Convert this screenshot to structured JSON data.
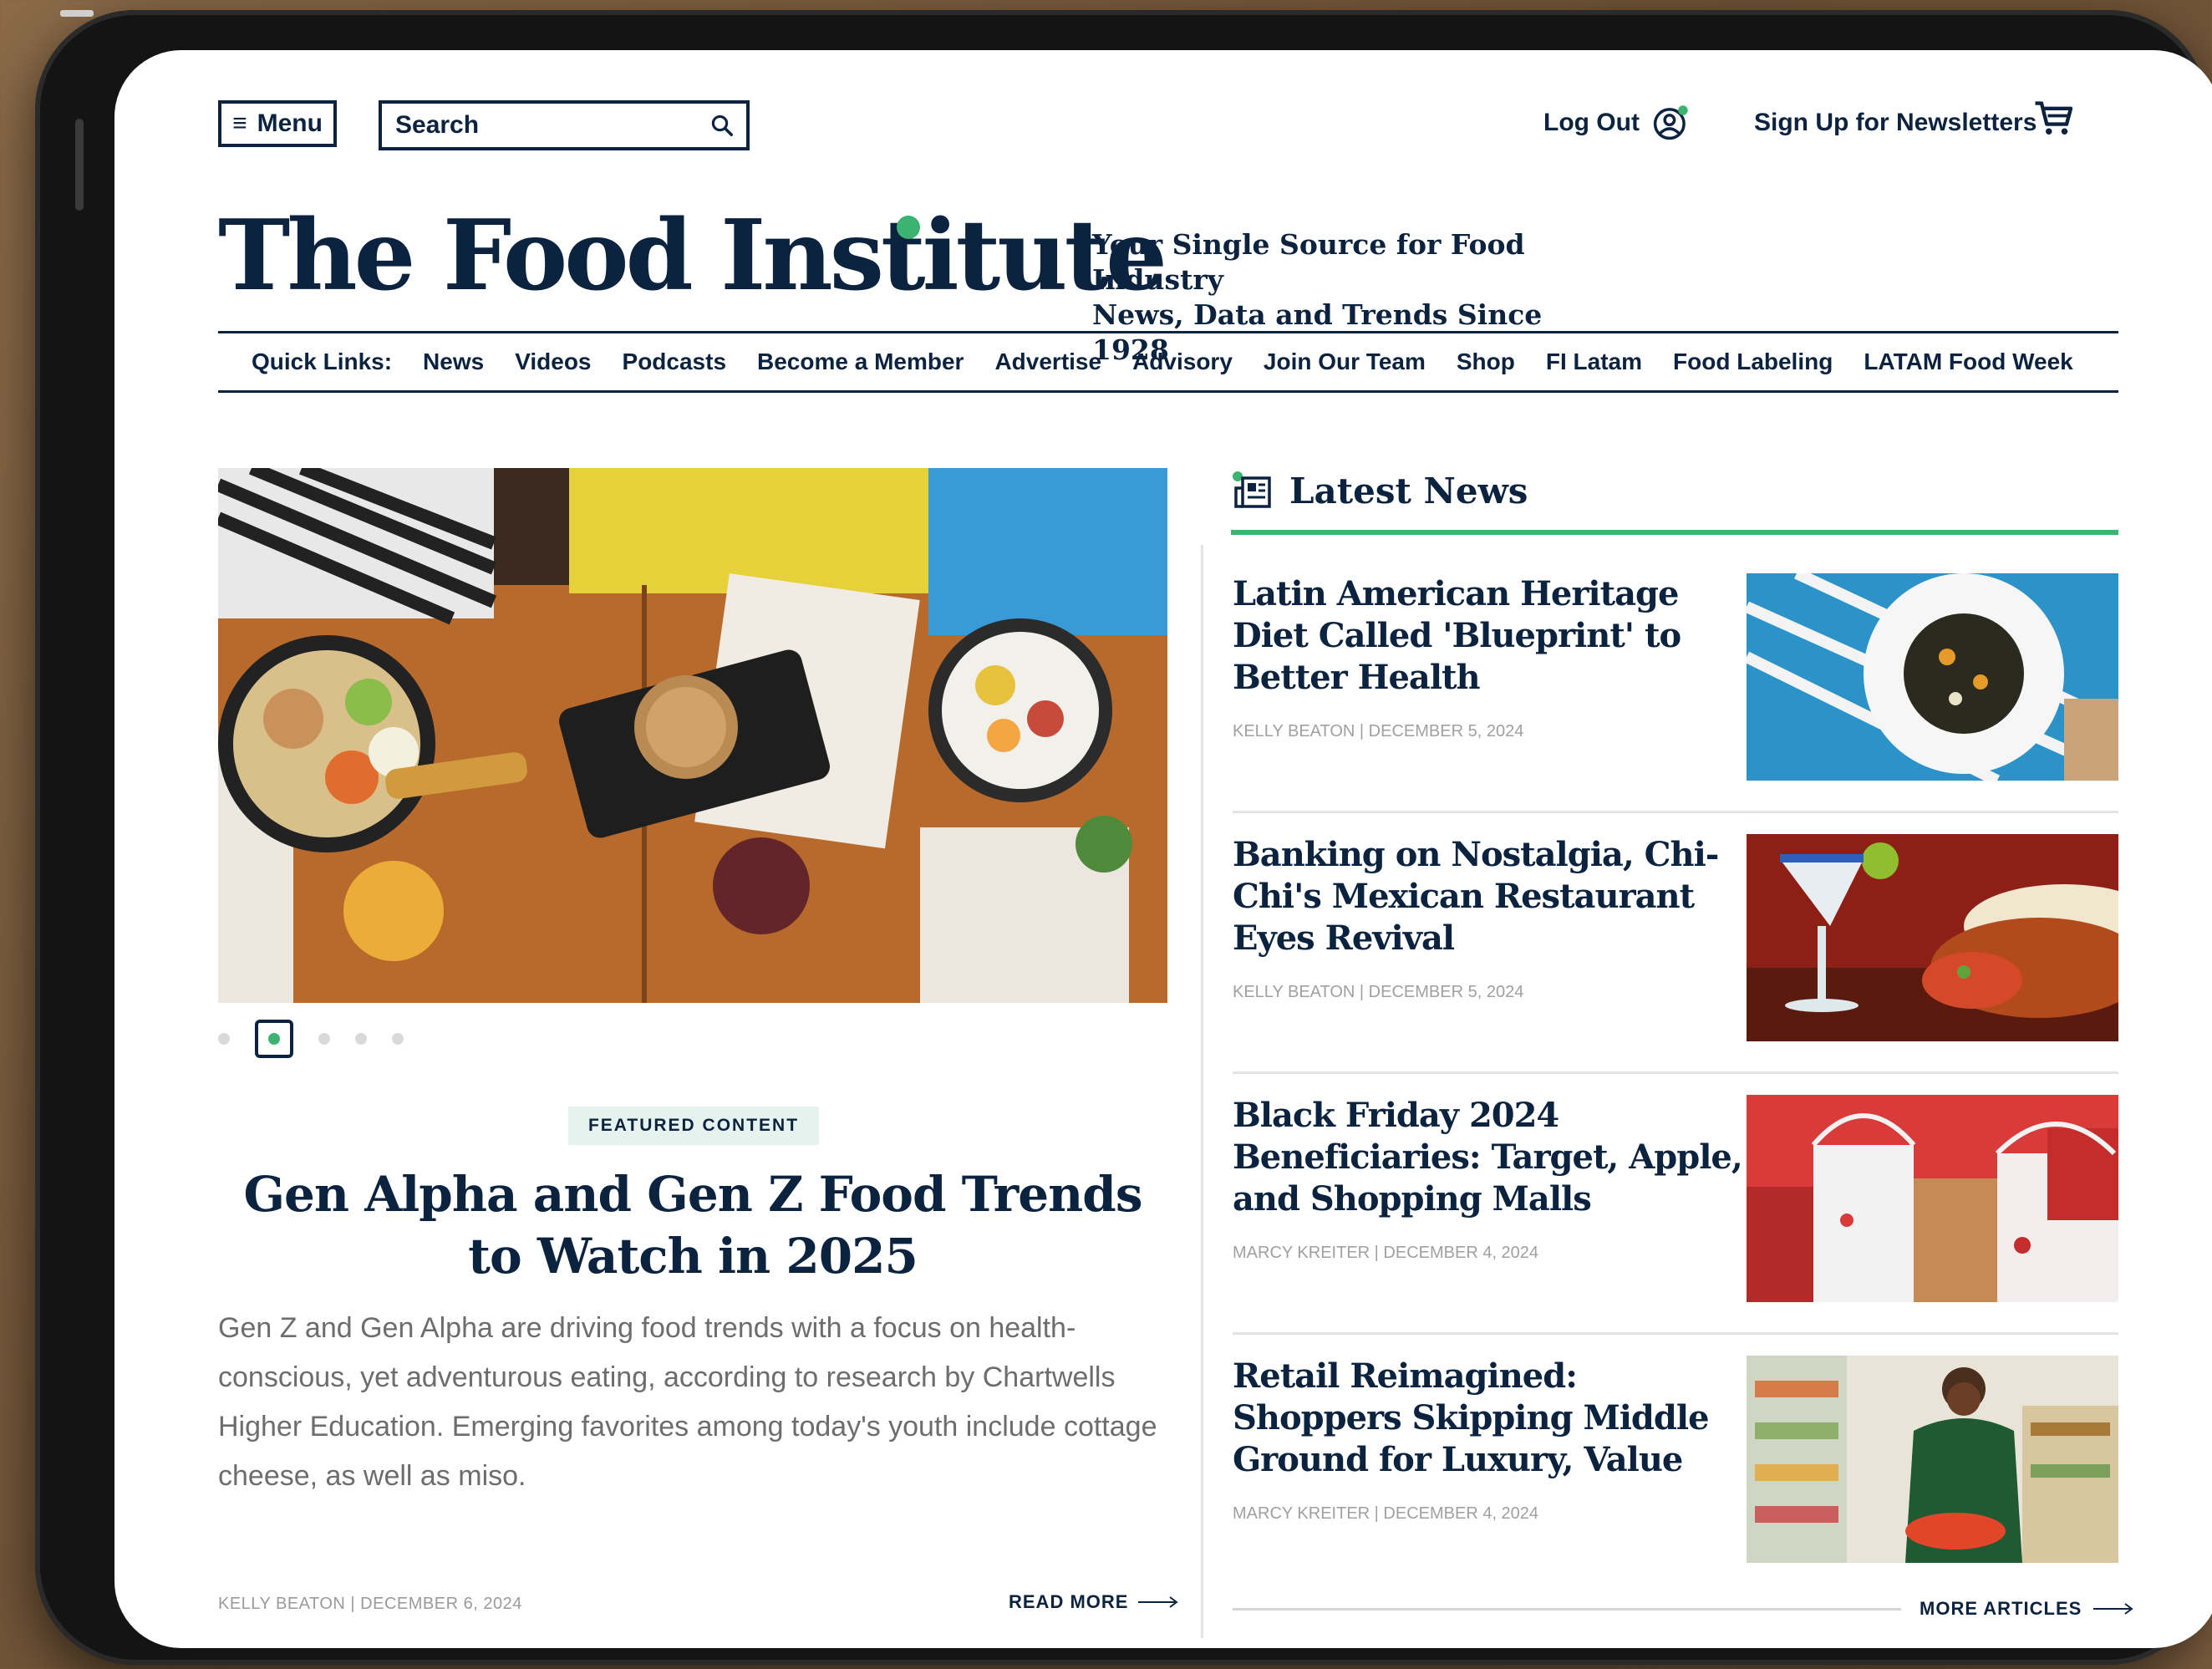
{
  "header": {
    "menu_label": "Menu",
    "search_placeholder": "Search",
    "logout_label": "Log Out",
    "newsletter_label": "Sign Up for Newsletters"
  },
  "brand": {
    "logo": "The Food Institute",
    "tagline_line1": "Your Single Source for Food Industry",
    "tagline_line2": "News, Data and Trends Since 1928",
    "accent_color": "#3cb371",
    "navy_color": "#0c2340"
  },
  "quick_links": {
    "label": "Quick Links:",
    "items": [
      "News",
      "Videos",
      "Podcasts",
      "Become a Member",
      "Advertise",
      "Advisory",
      "Join Our Team",
      "Shop",
      "FI Latam",
      "Food Labeling",
      "LATAM Food Week"
    ]
  },
  "featured": {
    "badge": "FEATURED CONTENT",
    "title": "Gen Alpha and Gen Z Food Trends to Watch in 2025",
    "description": "Gen Z and Gen Alpha are driving food trends with a focus on health-conscious, yet adventurous eating, according to research by Chartwells Higher Education. Emerging favorites among today's youth include cottage cheese, as well as miso.",
    "byline": "KELLY BEATON | DECEMBER 6, 2024",
    "read_more": "READ MORE",
    "carousel_total": 5,
    "carousel_active": 2
  },
  "latest": {
    "heading": "Latest News",
    "articles": [
      {
        "title": "Latin American Heritage Diet Called 'Blueprint' to Better Health",
        "byline": "KELLY BEATON | DECEMBER 5, 2024"
      },
      {
        "title": "Banking on Nostalgia, Chi-Chi's Mexican Restaurant Eyes Revival",
        "byline": "KELLY BEATON | DECEMBER 5, 2024"
      },
      {
        "title": "Black Friday 2024 Beneficiaries: Target, Apple, and Shopping Malls",
        "byline": "MARCY KREITER | DECEMBER 4, 2024"
      },
      {
        "title": "Retail Reimagined: Shoppers Skipping Middle Ground for Luxury, Value",
        "byline": "MARCY KREITER | DECEMBER 4, 2024"
      }
    ],
    "more_articles": "MORE ARTICLES"
  }
}
